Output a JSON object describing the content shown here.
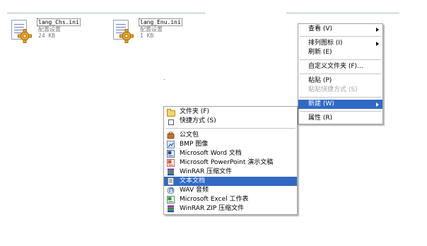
{
  "files": [
    {
      "name": "lang_Chs.ini",
      "type": "配置设置",
      "size": "24 KB"
    },
    {
      "name": "lang_Enu.ini",
      "type": "配置设置",
      "size": "1 KB"
    }
  ],
  "context_menu": {
    "items": [
      {
        "label": "查看 (V)",
        "submenu": true
      },
      {
        "sep": true
      },
      {
        "label": "排列图标 (I)",
        "submenu": true
      },
      {
        "label": "刷新 (E)"
      },
      {
        "sep": true
      },
      {
        "label": "自定义文件夹 (F)..."
      },
      {
        "sep": true
      },
      {
        "label": "粘贴 (P)"
      },
      {
        "label": "粘贴快捷方式 (S)",
        "disabled": true
      },
      {
        "sep": true
      },
      {
        "label": "新建 (W)",
        "submenu": true,
        "highlighted": true
      },
      {
        "sep": true
      },
      {
        "label": "属性 (R)"
      }
    ]
  },
  "new_submenu": {
    "items": [
      {
        "label": "文件夹 (F)",
        "icon": "folder-icon"
      },
      {
        "label": "快捷方式 (S)",
        "icon": "shortcut-icon"
      },
      {
        "sep": true
      },
      {
        "label": "公文包",
        "icon": "briefcase-icon"
      },
      {
        "label": "BMP 图像",
        "icon": "bmp-image-icon"
      },
      {
        "label": "Microsoft Word 文档",
        "icon": "word-document-icon"
      },
      {
        "label": "Microsoft PowerPoint 演示文稿",
        "icon": "powerpoint-presentation-icon"
      },
      {
        "label": "WinRAR 压缩文件",
        "icon": "winrar-archive-icon"
      },
      {
        "label": "文本文档",
        "icon": "text-document-icon",
        "highlighted": true
      },
      {
        "label": "WAV 音频",
        "icon": "wav-audio-icon"
      },
      {
        "label": "Microsoft Excel 工作表",
        "icon": "excel-worksheet-icon"
      },
      {
        "label": "WinRAR ZIP 压缩文件",
        "icon": "winrar-zip-icon"
      }
    ]
  },
  "colors": {
    "highlight": "#316ac5",
    "disabled_text": "#a8a8a8"
  }
}
